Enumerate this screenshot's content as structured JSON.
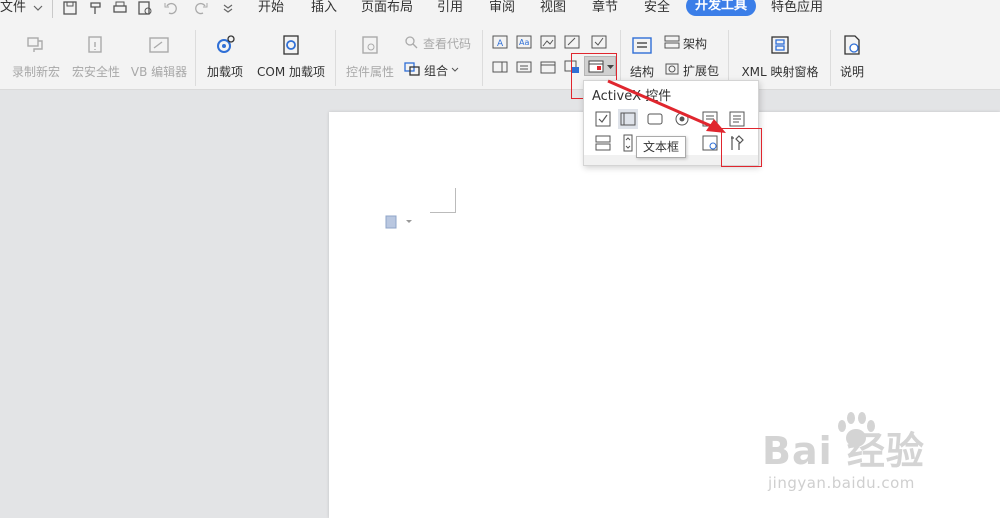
{
  "menubar": {
    "file": "文件",
    "tabs": [
      "开始",
      "插入",
      "页面布局",
      "引用",
      "审阅",
      "视图",
      "章节",
      "安全"
    ],
    "active_tab": "开发工具",
    "extra_tab": "特色应用"
  },
  "ribbon": {
    "record_macro": "录制新宏",
    "macro_security": "宏安全性",
    "vb_editor": "VB 编辑器",
    "addins": "加载项",
    "com_addins": "COM 加载项",
    "control_props": "控件属性",
    "view_code": "查看代码",
    "group": "组合",
    "structure": "结构",
    "schema": "架构",
    "expansion_pack": "扩展包",
    "xml_map": "XML 映射窗格",
    "help": "说明"
  },
  "popup": {
    "title": "ActiveX 控件",
    "tooltip": "文本框"
  },
  "watermark": {
    "brand": "Bai 经验",
    "url": "jingyan.baidu.com"
  },
  "colors": {
    "accent": "#3b7ee8",
    "highlight_red": "#e0262e"
  }
}
